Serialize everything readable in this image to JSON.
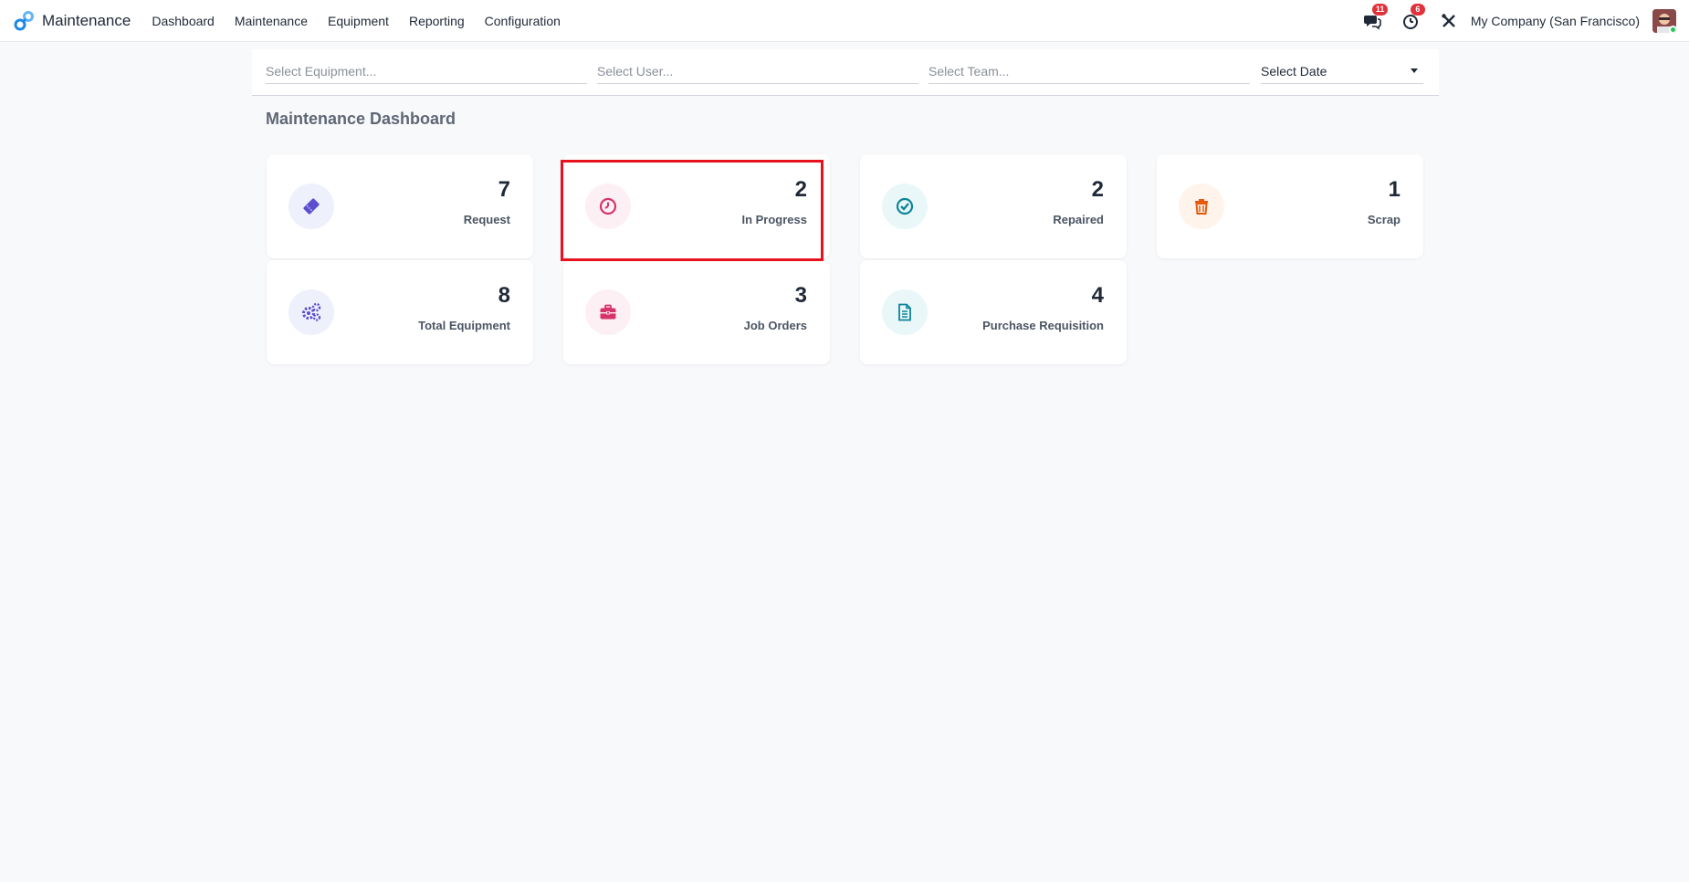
{
  "navbar": {
    "app_name": "Maintenance",
    "menu": [
      "Dashboard",
      "Maintenance",
      "Equipment",
      "Reporting",
      "Configuration"
    ],
    "messages_count": "11",
    "activities_count": "6",
    "company": "My Company (San Francisco)"
  },
  "filters": {
    "equipment_placeholder": "Select Equipment...",
    "user_placeholder": "Select User...",
    "team_placeholder": "Select Team...",
    "date_label": "Select Date"
  },
  "page_title": "Maintenance Dashboard",
  "cards": [
    {
      "value": "7",
      "label": "Request",
      "icon": "ticket-icon",
      "color": "#5b4fcf",
      "bg": "#eef0fb"
    },
    {
      "value": "2",
      "label": "In Progress",
      "icon": "clock-icon",
      "color": "#d6336c",
      "bg": "#fdf0f4"
    },
    {
      "value": "2",
      "label": "Repaired",
      "icon": "check-circle-icon",
      "color": "#0c8599",
      "bg": "#eaf7f9"
    },
    {
      "value": "1",
      "label": "Scrap",
      "icon": "trash-icon",
      "color": "#e8590c",
      "bg": "#fef4ec"
    },
    {
      "value": "8",
      "label": "Total Equipment",
      "icon": "gears-icon",
      "color": "#5b4fcf",
      "bg": "#eef0fb"
    },
    {
      "value": "3",
      "label": "Job Orders",
      "icon": "briefcase-icon",
      "color": "#d6336c",
      "bg": "#fdf0f4"
    },
    {
      "value": "4",
      "label": "Purchase Requisition",
      "icon": "document-icon",
      "color": "#0c8599",
      "bg": "#eaf7f9"
    }
  ],
  "colors": {
    "highlight_box": "#e8121e",
    "brand_icon": "#1e88e5"
  }
}
